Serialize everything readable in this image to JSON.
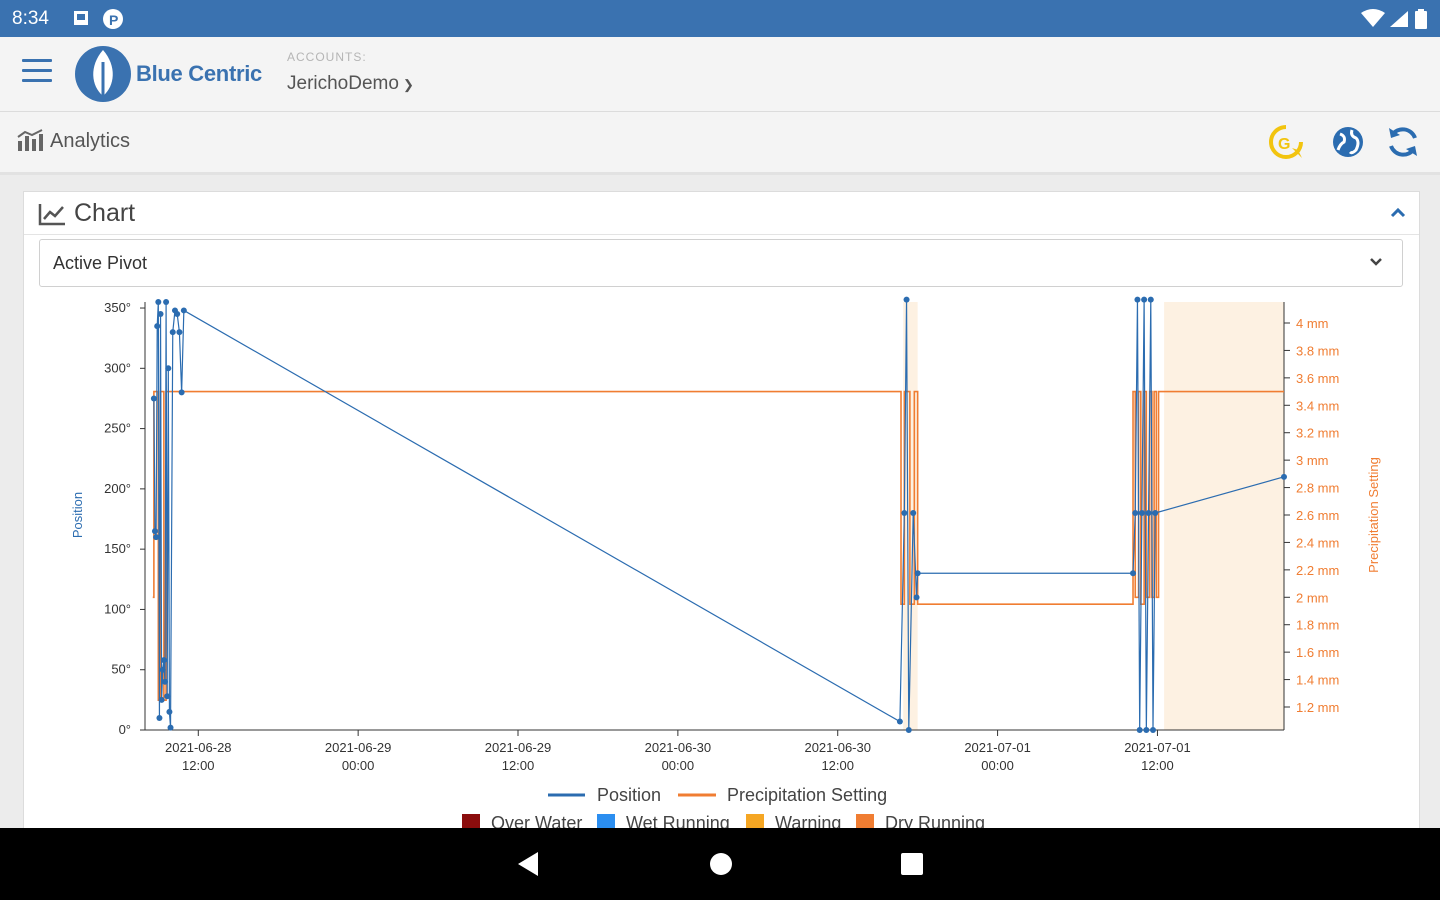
{
  "status_bar": {
    "time": "8:34"
  },
  "app_bar": {
    "brand": "Blue Centric",
    "accounts_label": "ACCOUNTS:",
    "account_value": "JerichoDemo"
  },
  "toolbar": {
    "page_title": "Analytics"
  },
  "card": {
    "title": "Chart",
    "selected_pivot": "Active Pivot"
  },
  "colors": {
    "primary": "#3a72b0",
    "position_line": "#2b6cb0",
    "precip_line": "#f07d32",
    "shade": "#fdf1e2",
    "refresh_icon": "#f2c40f"
  },
  "chart_data": {
    "type": "line",
    "y_left": {
      "label": "Position",
      "ticks": [
        "0°",
        "50°",
        "100°",
        "150°",
        "200°",
        "250°",
        "300°",
        "350°"
      ],
      "range": [
        0,
        355
      ]
    },
    "y_right": {
      "label": "Precipitation Setting",
      "ticks": [
        "1.2 mm",
        "1.4 mm",
        "1.6 mm",
        "1.8 mm",
        "2 mm",
        "2.2 mm",
        "2.4 mm",
        "2.6 mm",
        "2.8 mm",
        "3 mm",
        "3.2 mm",
        "3.4 mm",
        "3.6 mm",
        "3.8 mm",
        "4 mm"
      ]
    },
    "x_ticks": [
      {
        "date": "2021-06-28",
        "time": "12:00"
      },
      {
        "date": "2021-06-29",
        "time": "00:00"
      },
      {
        "date": "2021-06-29",
        "time": "12:00"
      },
      {
        "date": "2021-06-30",
        "time": "00:00"
      },
      {
        "date": "2021-06-30",
        "time": "12:00"
      },
      {
        "date": "2021-07-01",
        "time": "00:00"
      },
      {
        "date": "2021-07-01",
        "time": "12:00"
      }
    ],
    "x_range": [
      "2021-06-28T08:00",
      "2021-07-01T21:30"
    ],
    "series": [
      {
        "name": "Position",
        "points": [
          [
            "2021-06-28T08:40",
            275
          ],
          [
            "2021-06-28T08:45",
            165
          ],
          [
            "2021-06-28T08:50",
            160
          ],
          [
            "2021-06-28T08:55",
            335
          ],
          [
            "2021-06-28T09:00",
            355
          ],
          [
            "2021-06-28T09:05",
            10
          ],
          [
            "2021-06-28T09:10",
            345
          ],
          [
            "2021-06-28T09:15",
            25
          ],
          [
            "2021-06-28T09:20",
            50
          ],
          [
            "2021-06-28T09:25",
            58
          ],
          [
            "2021-06-28T09:30",
            40
          ],
          [
            "2021-06-28T09:35",
            355
          ],
          [
            "2021-06-28T09:40",
            28
          ],
          [
            "2021-06-28T09:45",
            300
          ],
          [
            "2021-06-28T09:50",
            15
          ],
          [
            "2021-06-28T09:55",
            2
          ],
          [
            "2021-06-28T10:05",
            330
          ],
          [
            "2021-06-28T10:15",
            348
          ],
          [
            "2021-06-28T10:25",
            345
          ],
          [
            "2021-06-28T10:35",
            330
          ],
          [
            "2021-06-28T10:45",
            280
          ],
          [
            "2021-06-28T10:55",
            348
          ],
          [
            "2021-06-30T16:40",
            7
          ],
          [
            "2021-06-30T17:00",
            180
          ],
          [
            "2021-06-30T17:10",
            357
          ],
          [
            "2021-06-30T17:20",
            0
          ],
          [
            "2021-06-30T17:40",
            180
          ],
          [
            "2021-06-30T17:55",
            110
          ],
          [
            "2021-06-30T18:00",
            130
          ],
          [
            "2021-07-01T10:10",
            130
          ],
          [
            "2021-07-01T10:20",
            180
          ],
          [
            "2021-07-01T10:30",
            357
          ],
          [
            "2021-07-01T10:40",
            0
          ],
          [
            "2021-07-01T10:50",
            180
          ],
          [
            "2021-07-01T11:00",
            357
          ],
          [
            "2021-07-01T11:10",
            0
          ],
          [
            "2021-07-01T11:20",
            180
          ],
          [
            "2021-07-01T11:30",
            357
          ],
          [
            "2021-07-01T11:40",
            0
          ],
          [
            "2021-07-01T11:50",
            180
          ],
          [
            "2021-07-01T21:30",
            210
          ]
        ]
      },
      {
        "name": "Precipitation Setting",
        "values_mm": [
          2.0,
          3.5,
          1.25,
          3.5,
          1.25,
          3.5,
          3.5,
          1.95,
          3.5,
          1.95,
          3.5,
          1.95,
          3.5,
          2.0,
          3.5,
          1.95,
          3.5,
          2.0,
          3.5,
          2.0,
          3.5,
          2.0,
          3.5
        ]
      }
    ],
    "shaded_ranges": [
      [
        "2021-06-30T16:55",
        "2021-06-30T18:00"
      ],
      [
        "2021-07-01T12:30",
        "2021-07-01T21:30"
      ]
    ],
    "legend": [
      "Position",
      "Precipitation Setting"
    ],
    "status_legend": [
      {
        "label": "Over Water",
        "color": "#8b0d0d"
      },
      {
        "label": "Wet Running",
        "color": "#2b8ef0"
      },
      {
        "label": "Warning",
        "color": "#f5a623"
      },
      {
        "label": "Dry Running",
        "color": "#f07d32"
      }
    ]
  }
}
